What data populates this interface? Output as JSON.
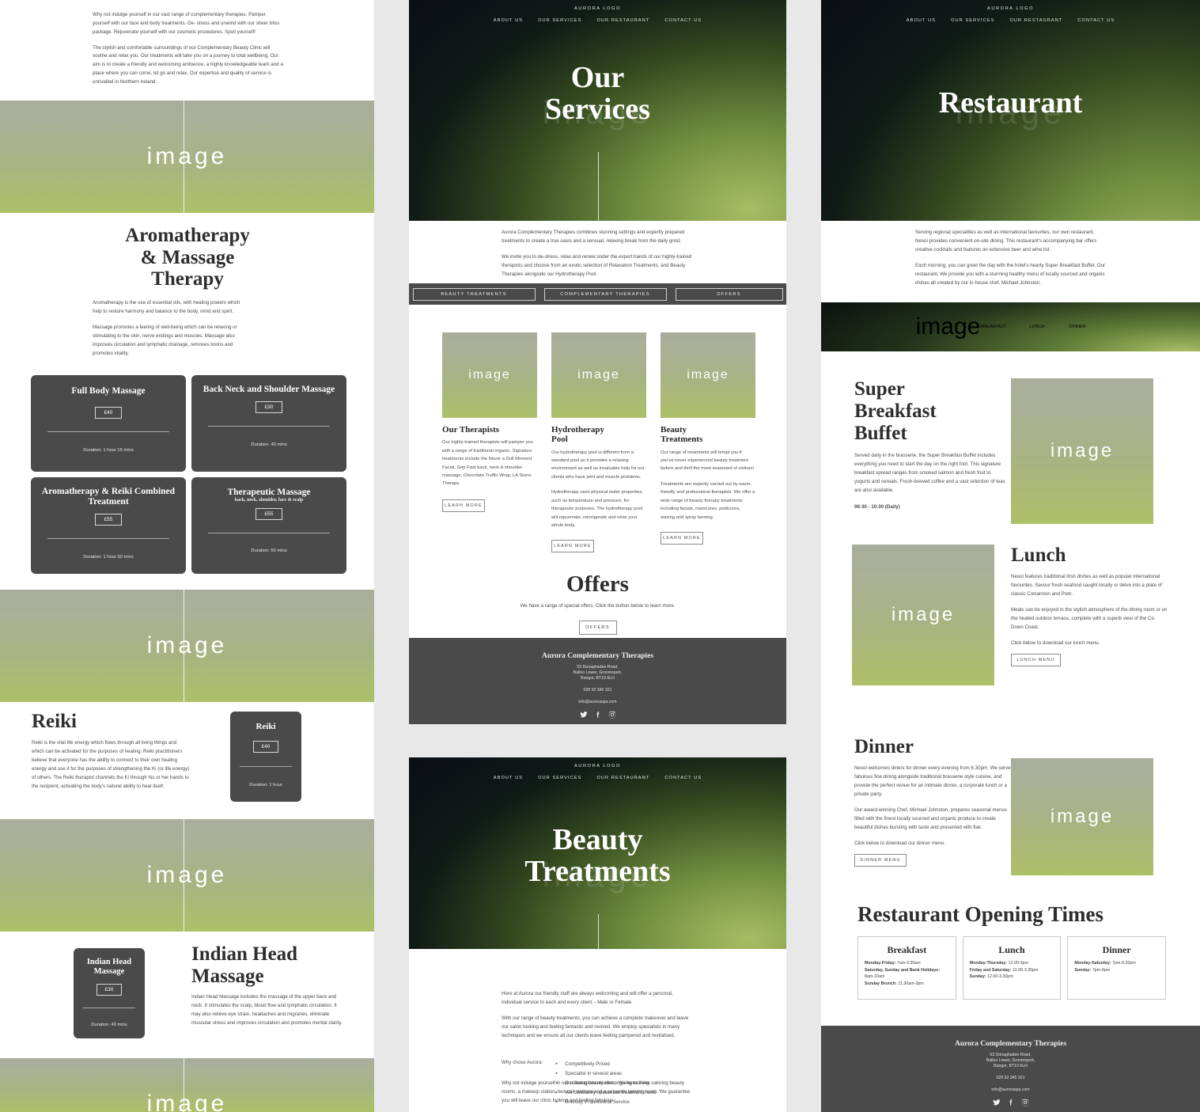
{
  "site": {
    "logo": "AURORA LOGO",
    "nav": [
      "ABOUT US",
      "OUR SERVICES",
      "OUR RESTAURANT",
      "CONTACT US"
    ],
    "image_placeholder": "image"
  },
  "footer": {
    "name": "Aurora Complementary Therapies",
    "address_line1": "53 Donaghadee Road,",
    "address_line2": "Balloo Lower, Groomsport,",
    "address_line3": "Bangor, BT19 6LH",
    "phone": "028 92 345 321",
    "email": "info@auroraspa.com",
    "social": [
      "twitter-icon",
      "facebook-icon",
      "instagram-icon"
    ]
  },
  "therapies_page": {
    "intro": [
      "Why not indulge yourself in our vast range of complementary therapies. Pamper yourself with our face and body treatments. De- stress and unwind with our sheer bliss package. Rejuvenate yourself with our cosmetic procedures. Spoil yourself!",
      "The stylish and comfortable surroundings of our Complementary Beauty Clinic will soothe and relax you. Our treatments will take you on a journey to total wellbeing. Our aim is to create a friendly and welcoming ambience, a highly knowledgeable team and a place where you can come, let go and relax. Our expertise and quality of service is unrivalled in Northern Ireland."
    ],
    "aroma": {
      "title_line1": "Aromatherapy",
      "title_line2": "& Massage",
      "title_line3": "Therapy",
      "paras": [
        "Aromatherapy is the use of essential oils, with healing powers which help to restore harmony and balance to the body, mind and spirit.",
        "Massage promotes a feeling of well-being which can be relaxing or stimulating to the skin, nerve endings and muscles. Massage also improves circulation and lymphatic drainage, removes toxins and promotes vitality."
      ]
    },
    "treatments": [
      {
        "title": "Full Body Massage",
        "sub": "",
        "price": "£40",
        "duration": "Duration: 1 hour 15 mins"
      },
      {
        "title": "Back Neck and Shoulder Massage",
        "sub": "",
        "price": "£30",
        "duration": "Duration: 40 mins"
      },
      {
        "title": "Aromatherapy & Reiki Combined Treatment",
        "sub": "",
        "price": "£55",
        "duration": "Duration: 1 hour 30 mins"
      },
      {
        "title": "Therapeutic Massage",
        "sub": "back, neck, shoulder, face & scalp",
        "price": "£55",
        "duration": "Duration: 50 mins"
      }
    ],
    "reiki": {
      "title": "Reiki",
      "para": "Reiki is the vital life energy which flows through all living things and which can be activated for the purposes of healing. Reiki practitioners believe that everyone has the ability to connect to their own healing energy and use it for the purposes of strengthening the Ki (or life energy) of others. The Reiki therapist channels the Ki through his or her hands to the recipient, activating the body's natural ability to heal itself.",
      "card": {
        "title": "Reiki",
        "price": "£40",
        "duration": "Duration: 1 hour"
      }
    },
    "indian_head": {
      "title_line1": "Indian Head",
      "title_line2": "Massage",
      "para": "Indian Head Massage includes the massage of the upper back and neck. It stimulates the scalp, blood flow and lymphatic circulation. It may also relieve eye strain, headaches and migranes, eliminate muscular stress and improves circulation and promotes mental clarity.",
      "card": {
        "title_line1": "Indian Head",
        "title_line2": "Massage",
        "price": "£30",
        "duration": "Duration: 40 mins"
      }
    }
  },
  "services_page": {
    "hero_line1": "Our",
    "hero_line2": "Services",
    "intro": [
      "Aurora Complementary Therapies combines stunning settings and expertly prepared treatments to create a true oasis and a sensual, relaxing break from the daily grind.",
      "We invite you to de-stress, relax and renew under the expert hands of our highly-trained therapists and choose from an exotic selection of Relaxation Treatments, and Beauty Therapies alongside our Hydrotherapy Pool."
    ],
    "tabs": [
      "BEAUTY TREATMENTS",
      "COMPLEMENTARY THERAPIES",
      "OFFERS"
    ],
    "cards": [
      {
        "title": "Our Therapists",
        "paras": [
          "Our highly-trained therapists will pamper you with a range of traditional organic. Signature treatments include the Never a Dull Moment Facial, Grip Fast back, neck & shoulder massage, Chocolate Truffle Wrap, LA Stone Therapy."
        ],
        "button": "LEARN MORE"
      },
      {
        "title_line1": "Hydrotherapy",
        "title_line2": "Pool",
        "title": "Hydrotherapy Pool",
        "paras": [
          "Our hydrotherapy pool is different from a standard pool as it provides a relaxing environment as well as invaluable help for our clients who have joint and muscle problems.",
          "Hydrotherapy uses physical water properties, such as temperature and pressure, for therapeutic purposes. The hydrotherapy pool will rejuvenate, reinvigorate and relax your whole body."
        ],
        "button": "LEARN MORE"
      },
      {
        "title_line1": "Beauty",
        "title_line2": "Treatments",
        "title": "Beauty Treatments",
        "paras": [
          "Our range of treatments will tempt you if you've never experienced beauty treatment before and thrill the most seasoned of visitors!",
          "Treatments are expertly carried out by warm, friendly and professional therapists. We offer a wide range of beauty therapy treatments including facials, manicures, pedicures, waxing and spray tanning."
        ],
        "button": "LEARN MORE"
      }
    ],
    "offers": {
      "title": "Offers",
      "subtitle": "We have a range of special offers. Click the button below to learn more.",
      "button": "OFFERS"
    }
  },
  "beauty_page": {
    "hero_line1": "Beauty",
    "hero_line2": "Treatments",
    "paras": [
      "Here at Aurora our friendly staff are always welcoming and will offer a personal, individual service to each and every client – Male or Female.",
      "With our range of beauty treatments, you can achieve a complete makeover and leave our salon looking and feeling fantastic and revived. We employ specialists in many techniques and we ensure all our clients leave feeling pampered and revitalised."
    ],
    "why_label": "Why chose Aurora:",
    "why_items": [
      "Competitively Priced",
      "Specialist in several areas",
      "Our therapists receive ongoing training",
      "We constantly update our treatment menu",
      "Friendly, Professional Service"
    ],
    "closing": "Why not indulge yourself in our relaxing beauty clinic. We have three calming beauty rooms, a makeup station, two nail stations and a separate tanning room. We guarantee you will leave our clinic looking and feeling fabulous."
  },
  "restaurant_page": {
    "hero_title": "Restaurant",
    "intro": [
      "Serving regional specialities as well as international favourites, our own restaurant, Nesoi provides convenient on-site dining. This restaurant's accompanying bar offers creative cocktails and features an extensive beer and wine list.",
      "Each morning, you can greet the day with the hotel's hearty Super Breakfast Buffet. Our restaurant, We provide you with a stunning healthy menu of locally sourced and organic dishes all created by our in house chef, Michael Johnston."
    ],
    "tabs": [
      "BREAKFAST",
      "LUNCH",
      "DINNER"
    ],
    "breakfast": {
      "title_line1": "Super",
      "title_line2": "Breakfast",
      "title_line3": "Buffet",
      "para": "Served daily in the brasserie, the Super Breakfast Buffet includes everything you need to start the day on the right foot. This signature breakfast spread ranges from smoked salmon and fresh fruit to yogurts and cereals. Fresh-brewed coffee and a vast selection of teas are also available.",
      "hours": "06:30 - 10:30 (Daily)"
    },
    "lunch": {
      "title": "Lunch",
      "paras": [
        "Nesoi features traditional Irish dishes as well as popular international favourites. Savour fresh seafood caught locally or delve into a plate of classic Colcannon and Pork.",
        "Meals can be enjoyed in the stylish atmosphere of the dining room or on the heated outdoor terrace, complete with a superb view of the Co. Down Coast.",
        "Click below to download our lunch menu."
      ],
      "button": "LUNCH MENU"
    },
    "dinner": {
      "title": "Dinner",
      "paras": [
        "Nesoi welcomes diners for dinner every evening from 6.30pm. We serve fabulous fine dining alongside traditional brasserie style cuisine, and provide the perfect venue for an intimate dinner, a corporate lunch or a private party.",
        "Our award-winning Chef, Michael Johnston, prepares seasonal menus filled with the finest locally sourced and organic produce to create beautiful dishes bursting with taste and presented with flair.",
        "Click below to download our dinner menu."
      ],
      "button": "DINNER MENU"
    },
    "opening_times": {
      "heading": "Restaurant Opening Times",
      "cards": [
        {
          "title": "Breakfast",
          "lines": [
            {
              "label": "Monday-Friday:",
              "value": "7am-9.30am"
            },
            {
              "label": "Saturday, Sunday and Bank Holidays:",
              "value": "8am-10am"
            },
            {
              "label": "Sunday Brunch:",
              "value": "11.30am-3pm"
            }
          ]
        },
        {
          "title": "Lunch",
          "lines": [
            {
              "label": "Monday-Thursday:",
              "value": "12.00-3pm"
            },
            {
              "label": "Friday and Saturday:",
              "value": "12.00-3.30pm"
            },
            {
              "label": "Sunday:",
              "value": "12.00-3.30pm"
            }
          ]
        },
        {
          "title": "Dinner",
          "lines": [
            {
              "label": "Monday-Saturday:",
              "value": "7pm-9.30pm"
            },
            {
              "label": "Sunday:",
              "value": "7pm-9pm"
            }
          ]
        }
      ]
    }
  },
  "colors": {
    "dark_panel": "#4a4a4a",
    "green_image": "#adc068",
    "text": "#4a4a4a"
  }
}
